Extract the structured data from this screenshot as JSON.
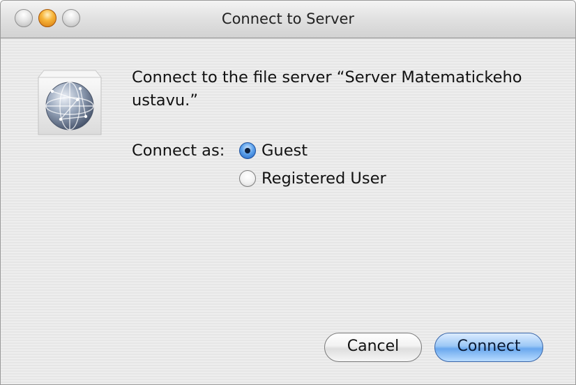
{
  "window": {
    "title": "Connect to Server"
  },
  "dialog": {
    "message": "Connect to the file server “Server Matematickeho ustavu.”",
    "connect_as_label": "Connect as:",
    "options": [
      {
        "label": "Guest",
        "selected": true
      },
      {
        "label": "Registered User",
        "selected": false
      }
    ],
    "buttons": {
      "cancel_label": "Cancel",
      "connect_label": "Connect"
    }
  },
  "colors": {
    "accent": "#5fa3ec",
    "minimize": "#f7b53a"
  }
}
